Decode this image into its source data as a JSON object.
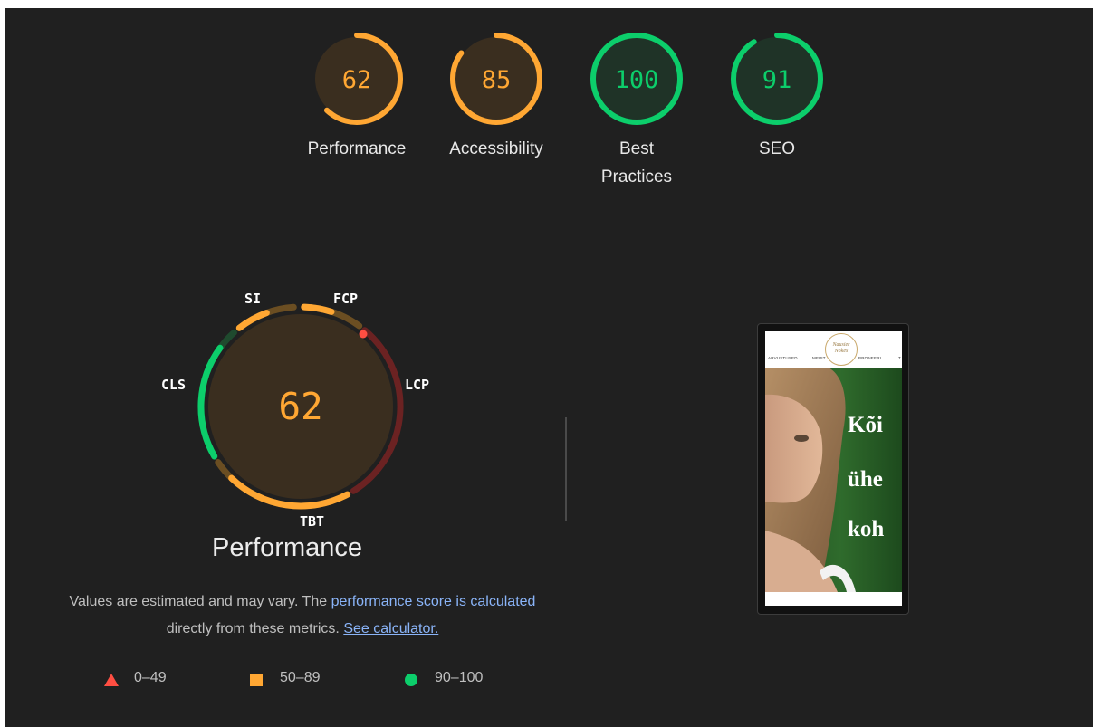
{
  "colors": {
    "orange": "#ffa733",
    "orange_bg": "#3a2e1f",
    "green": "#0cce6b",
    "green_bg": "#1f3327",
    "red": "#ff4e42",
    "red_dim": "#6b2222",
    "link": "#8ab4f8"
  },
  "categories": [
    {
      "id": "performance",
      "score": "62",
      "score_value": 62,
      "label_lines": [
        "Performance"
      ],
      "rating": "average"
    },
    {
      "id": "accessibility",
      "score": "85",
      "score_value": 85,
      "label_lines": [
        "Accessibility"
      ],
      "rating": "average"
    },
    {
      "id": "best-practices",
      "score": "100",
      "score_value": 100,
      "label_lines": [
        "Best",
        "Practices"
      ],
      "rating": "pass"
    },
    {
      "id": "seo",
      "score": "91",
      "score_value": 91,
      "label_lines": [
        "SEO"
      ],
      "rating": "pass"
    }
  ],
  "performance": {
    "score": "62",
    "title": "Performance",
    "metrics": {
      "si": "SI",
      "fcp": "FCP",
      "lcp": "LCP",
      "tbt": "TBT",
      "cls": "CLS"
    },
    "note": {
      "text1": "Values are estimated and may vary. The ",
      "link1": "performance score is calculated",
      "text2": " directly from these metrics. ",
      "link2": "See calculator."
    },
    "legend": [
      {
        "range": "0–49",
        "shape": "triangle",
        "color": "#ff4e42"
      },
      {
        "range": "50–89",
        "shape": "square",
        "color": "#ffa733"
      },
      {
        "range": "90–100",
        "shape": "circle",
        "color": "#0cce6b"
      }
    ]
  },
  "screenshot": {
    "nav": {
      "item1": "ARVUSTUSED",
      "item2": "MEIST",
      "item3": "BRONEERI",
      "item4": "T"
    },
    "logo": {
      "line1": "Nausier",
      "line2": "Nokes"
    },
    "hero_lines": [
      "Kõi",
      "ühe",
      "koh"
    ]
  }
}
